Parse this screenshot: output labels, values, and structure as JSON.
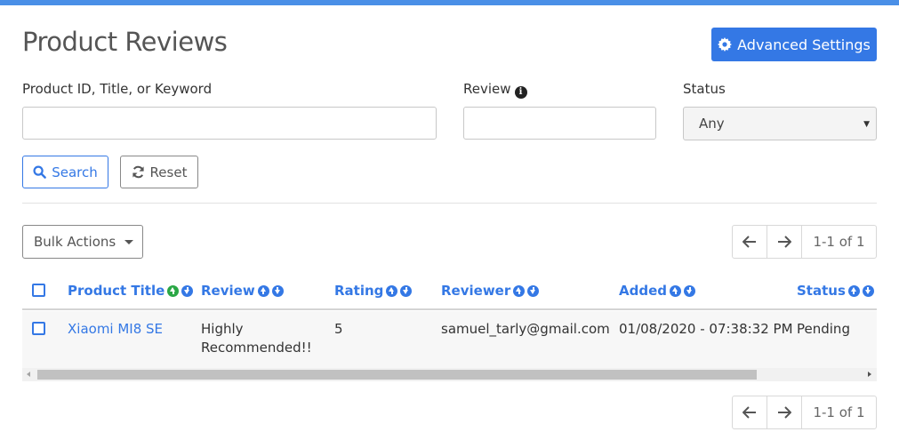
{
  "header": {
    "title": "Product Reviews",
    "advanced_settings_label": "Advanced Settings",
    "advanced_settings_icon": "gear-icon"
  },
  "filters": {
    "keyword_label": "Product ID, Title, or Keyword",
    "keyword_value": "",
    "review_label": "Review",
    "review_value": "",
    "status_label": "Status",
    "status_selected": "Any",
    "search_label": "Search",
    "reset_label": "Reset"
  },
  "toolbar": {
    "bulk_actions_label": "Bulk Actions"
  },
  "pagination": {
    "range_text": "1-1 of 1"
  },
  "table": {
    "columns": [
      "Product Title",
      "Review",
      "Rating",
      "Reviewer",
      "Added",
      "Status"
    ],
    "rows": [
      {
        "product_title": "Xiaomi MI8 SE",
        "review": "Highly Recommended!!",
        "rating": "5",
        "reviewer": "samuel_tarly@gmail.com",
        "added": "01/08/2020 - 07:38:32 PM",
        "status": "Pending"
      }
    ]
  },
  "colors": {
    "accent": "#3478e5",
    "topbar": "#4a8fe7",
    "active_sort": "#2aa745"
  }
}
